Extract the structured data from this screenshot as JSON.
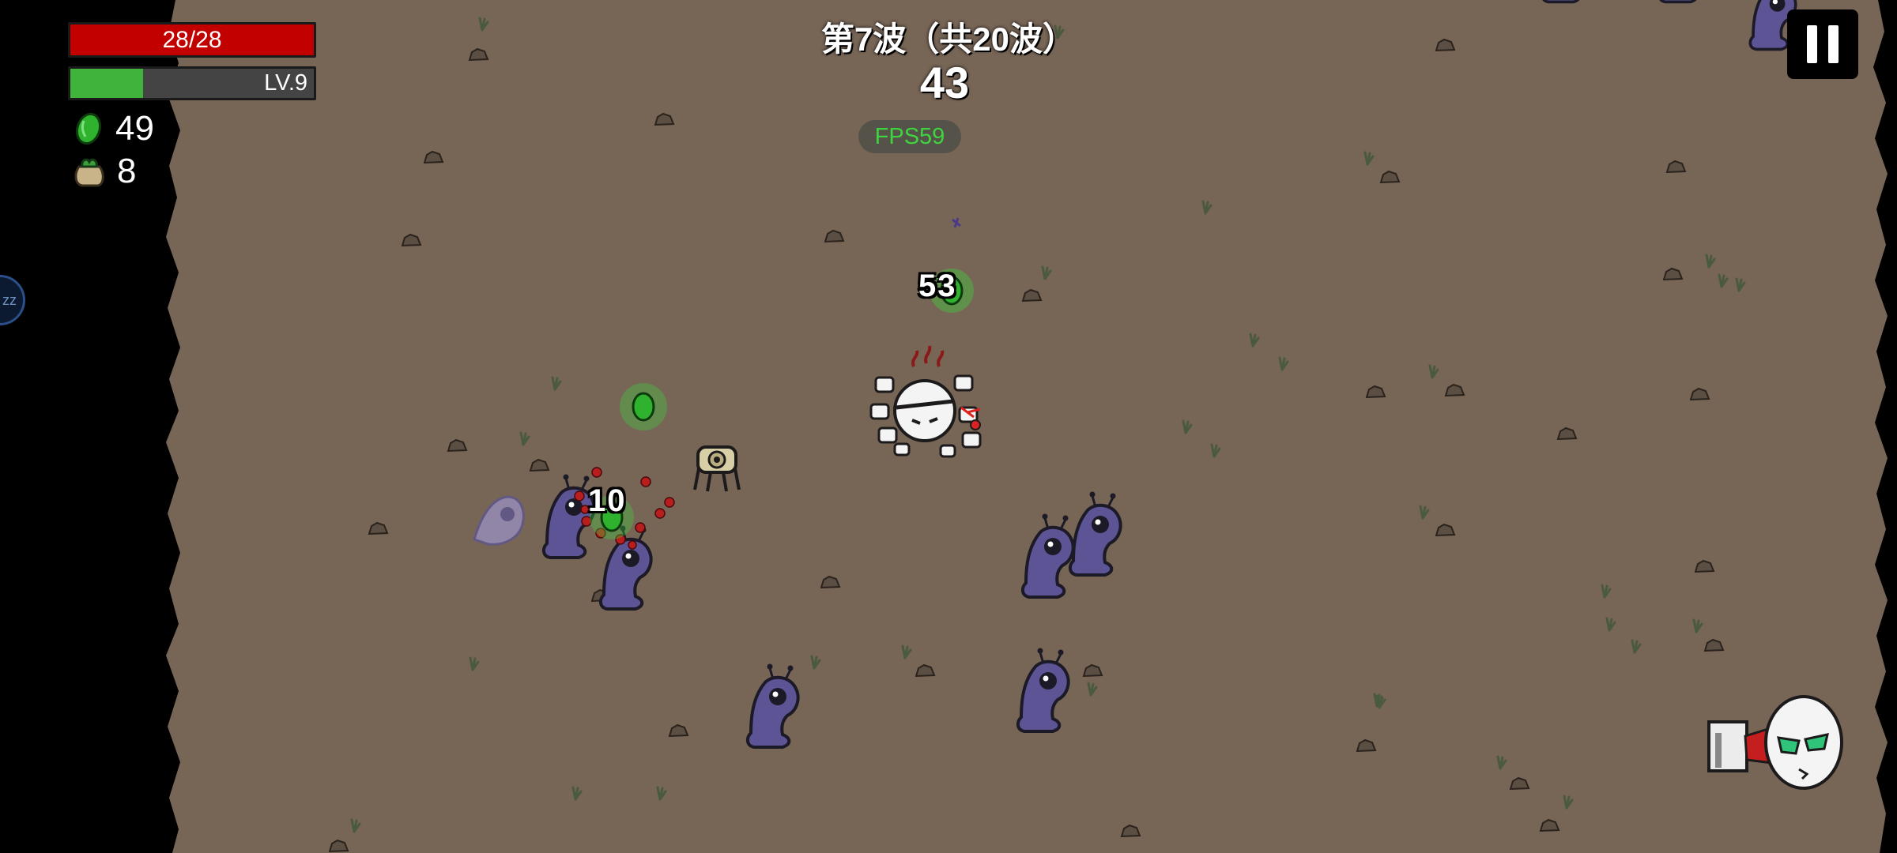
{
  "hud": {
    "health": {
      "current": 28,
      "max": 28,
      "text": "28/28"
    },
    "level": {
      "text": "LV.9",
      "xp_progress": 0.3
    },
    "materials": {
      "icon": "material-icon",
      "count": "49"
    },
    "bag": {
      "icon": "loot-bag-icon",
      "count": "8"
    },
    "fps": "FPS59"
  },
  "wave": {
    "title": "第7波（共20波）",
    "timer": "43"
  },
  "floating_damage": [
    {
      "text": "53"
    },
    {
      "text": "10"
    }
  ],
  "side_button": {
    "label": "zz"
  },
  "colors": {
    "ground": "#776556",
    "health": "#c20000",
    "xp": "#3fb33b",
    "fps_text": "#3fd43f",
    "enemy": "#5c5494",
    "material": "#2fb32f"
  }
}
